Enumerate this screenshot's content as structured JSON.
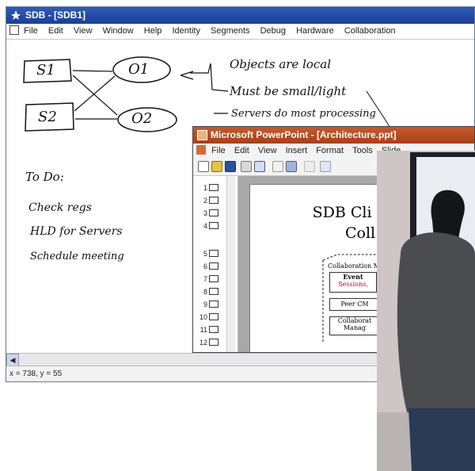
{
  "sdb_window": {
    "title": "SDB - [SDB1]",
    "menu": [
      "File",
      "Edit",
      "View",
      "Window",
      "Help",
      "Identity",
      "Segments",
      "Debug",
      "Hardware",
      "Collaboration"
    ],
    "status": "x = 738, y = 55"
  },
  "whiteboard": {
    "nodes": [
      "S1",
      "S2",
      "O1",
      "O2"
    ],
    "notes": [
      "Objects are local",
      "Must be small/light",
      "Servers do most processing"
    ],
    "todo_title": "To Do:",
    "todo_items": [
      "Check regs",
      "HLD for Servers",
      "Schedule meeting"
    ]
  },
  "ppt_window": {
    "title": "Microsoft PowerPoint - [Architecture.ppt]",
    "menu": [
      "File",
      "Edit",
      "View",
      "Insert",
      "Format",
      "Tools",
      "Slide"
    ],
    "slide_numbers": [
      "1",
      "2",
      "3",
      "4",
      "5",
      "6",
      "7",
      "8",
      "9",
      "10",
      "11",
      "12"
    ],
    "slide_title_line1": "SDB Cli",
    "slide_title_line2": "Coll",
    "diagram": {
      "box1": "Collaboration M",
      "box2_line1": "Event",
      "box2_line2": "Sessions,",
      "box3": "Peer CM",
      "box4_line1": "Collaborat",
      "box4_line2": "Manag"
    }
  },
  "colors": {
    "sdb_title_bar": "#1f4aa8",
    "ppt_title_bar": "#b54a20"
  }
}
